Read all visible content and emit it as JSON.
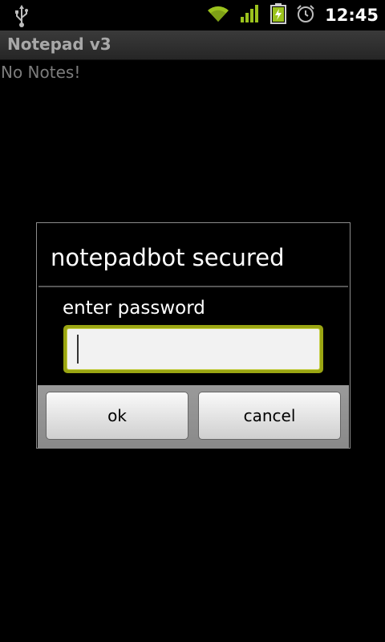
{
  "status_bar": {
    "time": "12:45",
    "icons": [
      "usb-icon",
      "wifi-icon",
      "signal-icon",
      "battery-charging-icon",
      "alarm-icon"
    ],
    "accent_color": "#9bc21d"
  },
  "app": {
    "title": "Notepad v3",
    "empty_message": "No Notes!"
  },
  "dialog": {
    "title": "notepadbot secured",
    "label": "enter password",
    "password_value": "",
    "ok_label": "ok",
    "cancel_label": "cancel",
    "focus_color": "#9aa512"
  }
}
